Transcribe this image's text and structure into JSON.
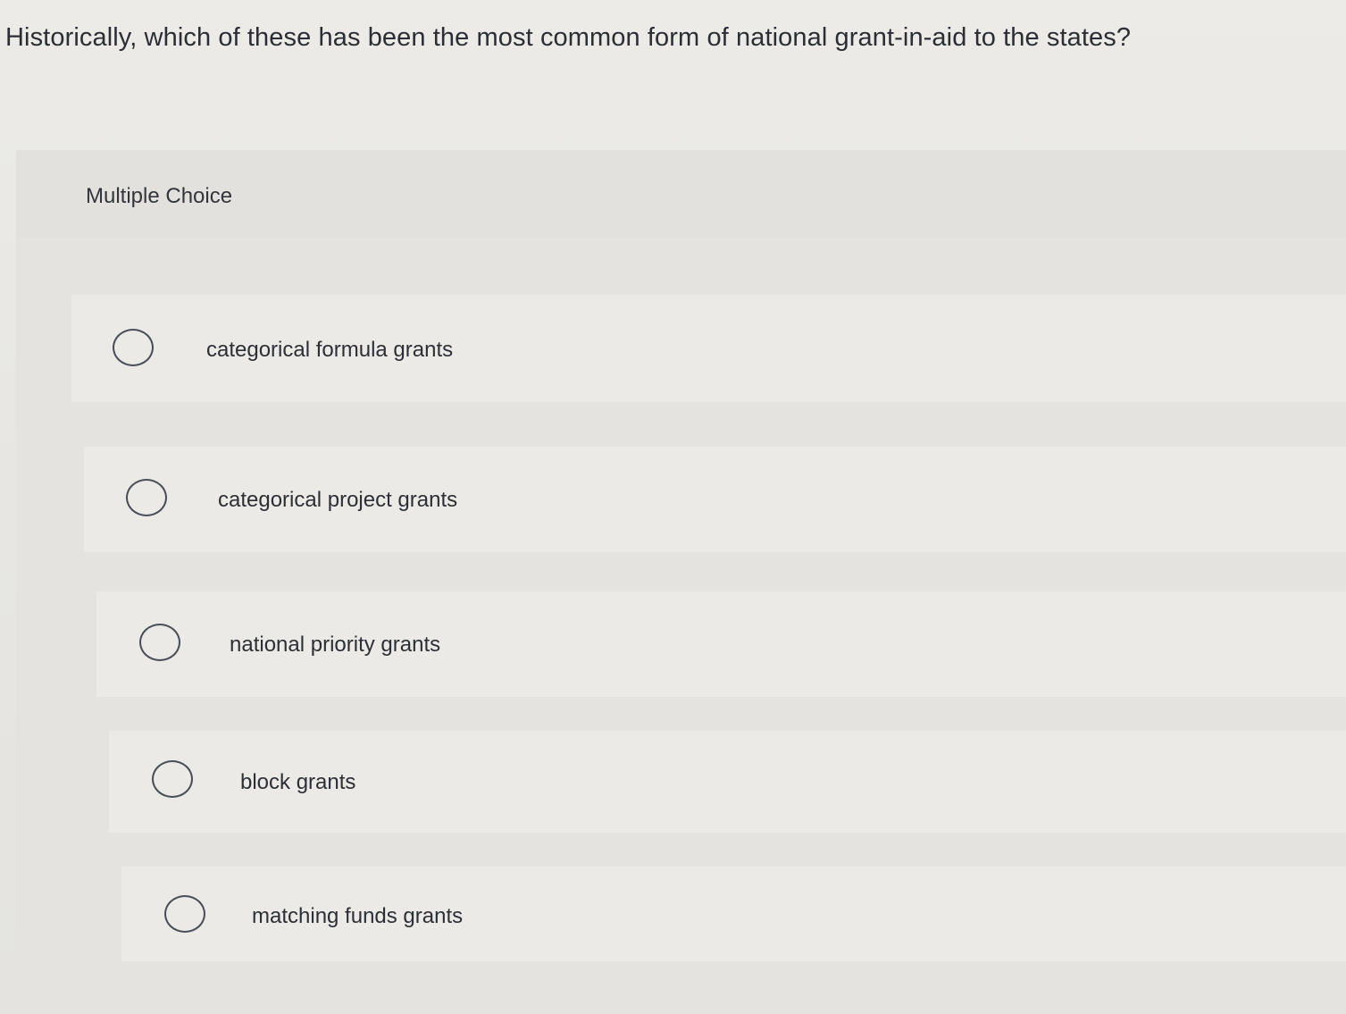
{
  "question": {
    "text": "Historically, which of these has been the most common form of national grant-in-aid to the states?"
  },
  "question_type": {
    "label": "Multiple Choice"
  },
  "options": [
    {
      "label": "categorical formula grants",
      "selected": false
    },
    {
      "label": "categorical project grants",
      "selected": false
    },
    {
      "label": "national priority grants",
      "selected": false
    },
    {
      "label": "block grants",
      "selected": false
    },
    {
      "label": "matching funds grants",
      "selected": false
    }
  ]
}
